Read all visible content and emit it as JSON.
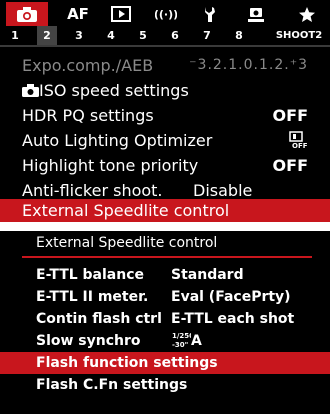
{
  "colors": {
    "accent": "#c8161d",
    "background": "#000000",
    "text": "#ffffff",
    "dim_text": "#8a8a8a"
  },
  "tabs": [
    {
      "icon": "camera-icon",
      "active": true
    },
    {
      "label": "AF"
    },
    {
      "icon": "playback-icon"
    },
    {
      "icon": "wireless-icon"
    },
    {
      "icon": "wrench-icon"
    },
    {
      "icon": "custom-function-icon"
    },
    {
      "icon": "star-icon"
    }
  ],
  "subtabs": [
    "1",
    "2",
    "3",
    "4",
    "5",
    "6",
    "7",
    "8",
    "SHOOT2"
  ],
  "active_subtab": "2",
  "menu1": [
    {
      "label": "Expo.comp./AEB",
      "value": "⁻3.2.1.0.1.2.⁺3",
      "dim": true
    },
    {
      "label": "ISO speed settings",
      "value": "",
      "icon": "camera-icon"
    },
    {
      "label": "HDR PQ settings",
      "value": "OFF"
    },
    {
      "label": "Auto Lighting Optimizer",
      "value": "",
      "icon": "alo-off-icon"
    },
    {
      "label": "Highlight tone priority",
      "value": "OFF"
    },
    {
      "label": "Anti-flicker shoot.",
      "value": "Disable"
    },
    {
      "label": "External Speedlite control",
      "value": "",
      "selected": true
    }
  ],
  "screen2": {
    "title": "External Speedlite control",
    "rows": [
      {
        "label": "E-TTL balance",
        "value": "Standard"
      },
      {
        "label": "E-TTL II meter.",
        "value": "Eval (FacePrty)"
      },
      {
        "label": "Contin flash ctrl",
        "value": "E-TTL each shot"
      },
      {
        "label": "Slow synchro",
        "value": "A",
        "value_prefix": "1/250–30\""
      },
      {
        "label": "Flash function settings",
        "value": "",
        "selected": true
      },
      {
        "label": "Flash C.Fn settings",
        "value": ""
      }
    ]
  }
}
